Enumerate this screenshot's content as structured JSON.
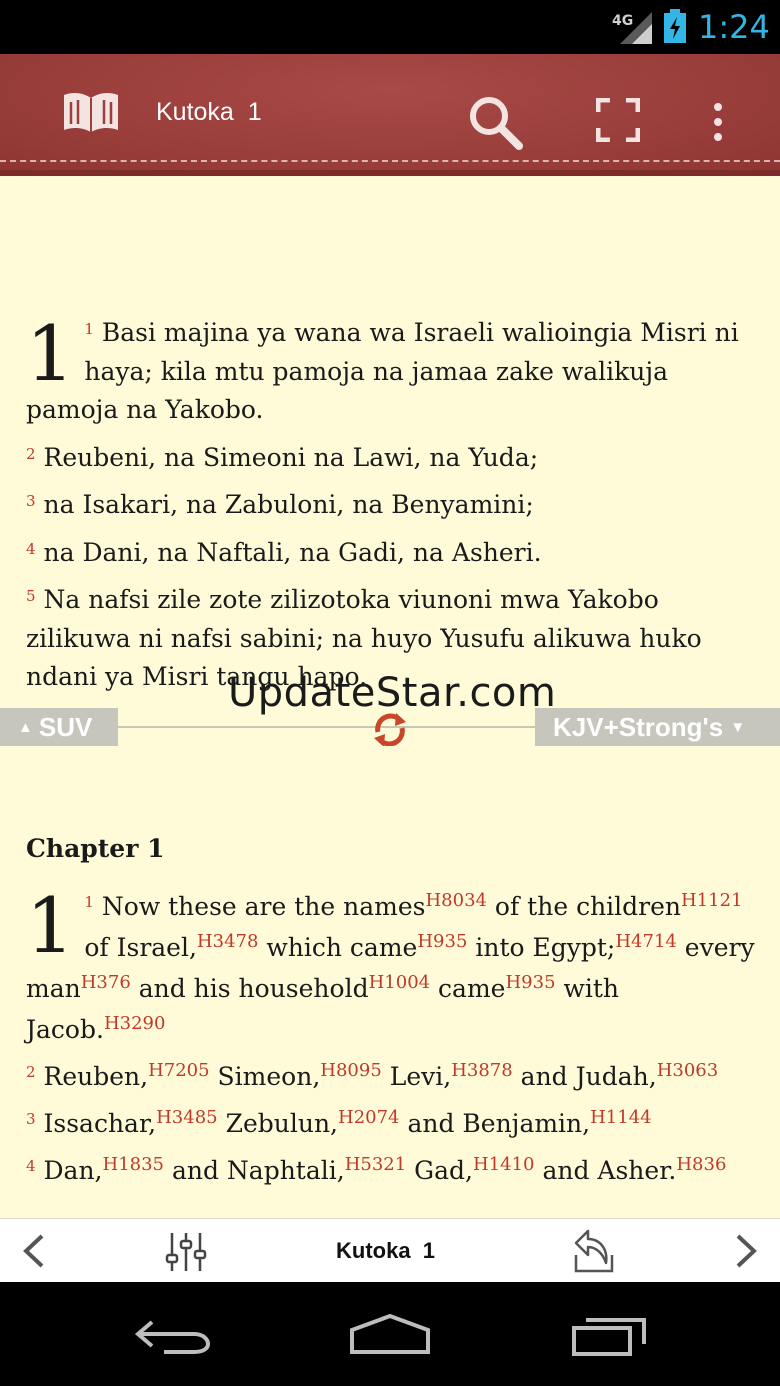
{
  "status_bar": {
    "network": "4G",
    "time": "1:24"
  },
  "action_bar": {
    "title": "Kutoka  1",
    "icons": [
      "book-icon",
      "search-icon",
      "fullscreen-icon",
      "more-vert-icon"
    ]
  },
  "top_pane": {
    "chapter_number": "1",
    "verses": [
      {
        "num": "1",
        "text": "Basi majina ya wana wa Israeli walioingia Misri ni haya; kila mtu pamoja na jamaa zake walikuja pamoja na Yakobo."
      },
      {
        "num": "2",
        "text": "Reubeni, na Simeoni na Lawi, na Yuda;"
      },
      {
        "num": "3",
        "text": "na Isakari, na Zabuloni, na Benyamini;"
      },
      {
        "num": "4",
        "text": "na Dani, na Naftali, na Gadi, na Asheri."
      },
      {
        "num": "5",
        "text": "Na nafsi zile zote zilizotoka viunoni mwa Yakobo zilikuwa ni nafsi sabini; na huyo Yusufu alikuwa huko ndani ya Misri tangu hapo."
      }
    ]
  },
  "divider": {
    "left_version": "SUV",
    "right_version": "KJV+Strong's",
    "up_arrow": "▲",
    "down_arrow": "▼"
  },
  "watermark": "UpdateStar.com",
  "bottom_pane": {
    "chapter_heading": "Chapter 1",
    "chapter_number": "1",
    "v1": {
      "num": "1",
      "t1": "Now these are the names",
      "s1": "H8034",
      "t2": " of the children",
      "s2": "H1121",
      "t3": " of Israel,",
      "s3": "H3478",
      "t4": " which came",
      "s4": "H935",
      "t5": " into Egypt;",
      "s5": "H4714",
      "t6": " every man",
      "s6": "H376",
      "t7": " and his household",
      "s7": "H1004",
      "t8": " came",
      "s8": "H935",
      "t9": " with Jacob.",
      "s9": "H3290"
    },
    "v2": {
      "num": "2",
      "t1": "Reuben,",
      "s1": "H7205",
      "t2": " Simeon,",
      "s2": "H8095",
      "t3": " Levi,",
      "s3": "H3878",
      "t4": " and Judah,",
      "s4": "H3063"
    },
    "v3": {
      "num": "3",
      "t1": "Issachar,",
      "s1": "H3485",
      "t2": " Zebulun,",
      "s2": "H2074",
      "t3": " and Benjamin,",
      "s3": "H1144"
    },
    "v4": {
      "num": "4",
      "t1": "Dan,",
      "s1": "H1835",
      "t2": " and Naphtali,",
      "s2": "H5321",
      "t3": " Gad,",
      "s3": "H1410",
      "t4": " and Asher.",
      "s4": "H836"
    }
  },
  "toolbar": {
    "title": "Kutoka  1",
    "icons": [
      "chevron-left-icon",
      "sliders-icon",
      "share-icon",
      "chevron-right-icon"
    ]
  },
  "colors": {
    "accent_red": "#9b3f3c",
    "page_bg": "#fffbd9",
    "verse_number": "#c0392b",
    "status_time": "#33b5e5"
  }
}
